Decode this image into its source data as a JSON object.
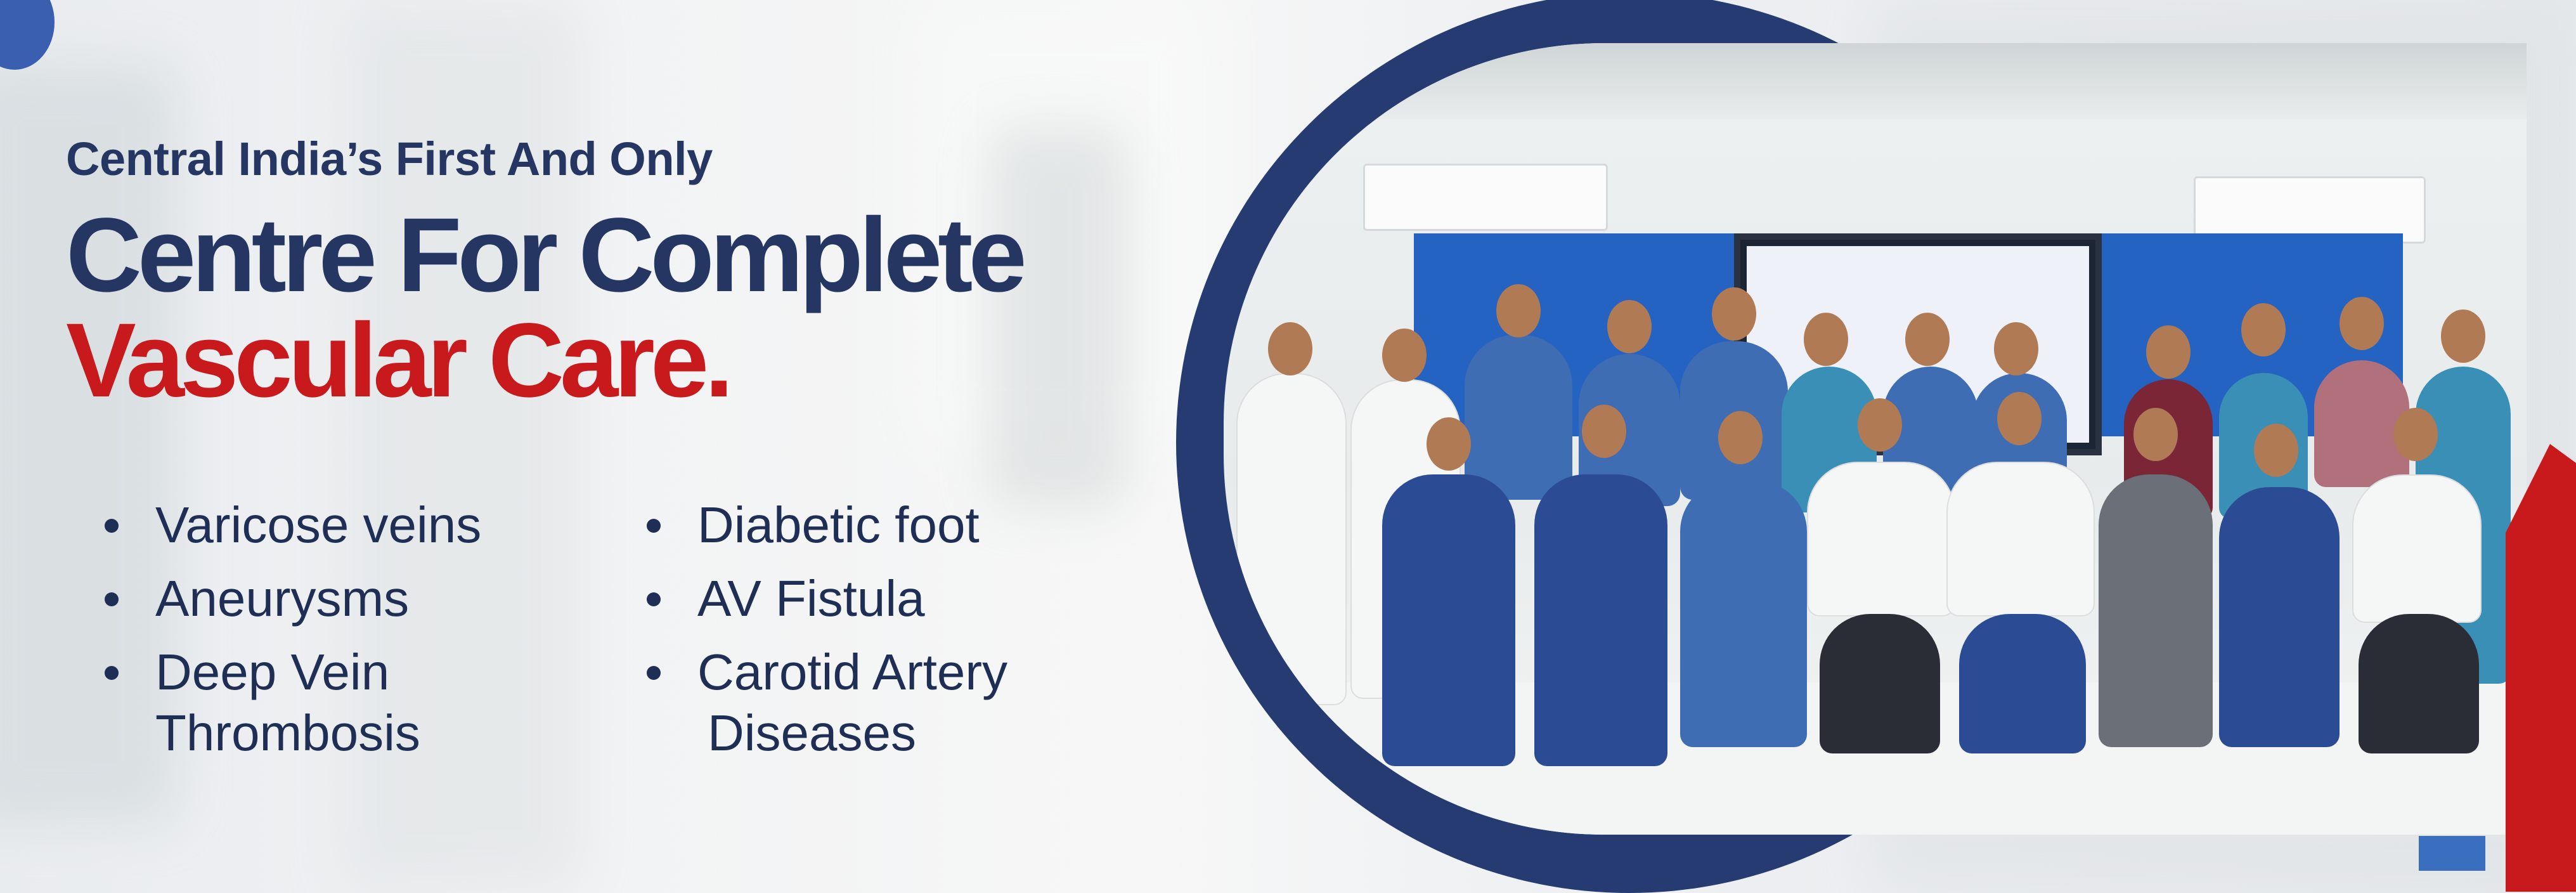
{
  "hero": {
    "eyebrow": "Central India’s First And Only",
    "headline_line1": "Centre For Complete",
    "headline_line2": "Vascular Care.",
    "services_col1": [
      {
        "line1": "Varicose veins",
        "line2": ""
      },
      {
        "line1": "Aneurysms",
        "line2": ""
      },
      {
        "line1": "Deep Vein",
        "line2": "Thrombosis"
      }
    ],
    "services_col2": [
      {
        "line1": "Diabetic foot",
        "line2": ""
      },
      {
        "line1": "AV Fistula",
        "line2": ""
      },
      {
        "line1": "Carotid Artery",
        "line2": "Diseases"
      }
    ]
  },
  "colors": {
    "navy": "#253662",
    "red": "#c8191c",
    "accent_blue": "#3a6fc0"
  }
}
